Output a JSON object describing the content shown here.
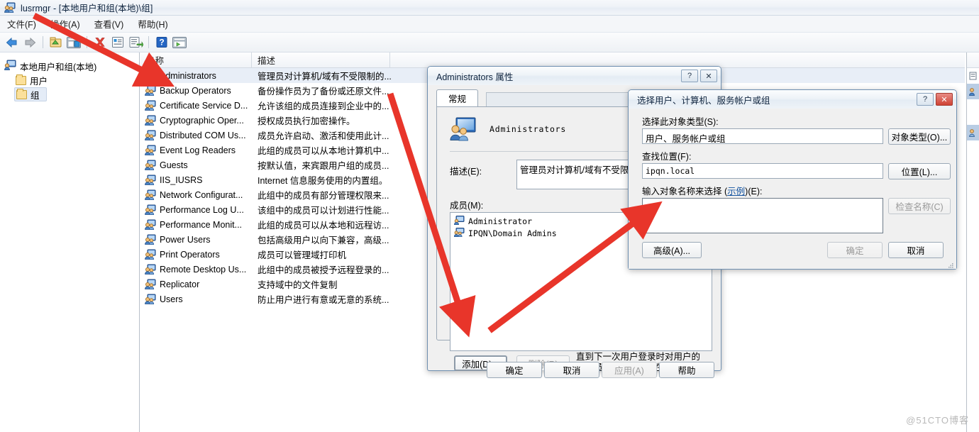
{
  "window": {
    "title": "lusrmgr - [本地用户和组(本地)\\组]",
    "icon": "users-group-icon",
    "menu": [
      "文件(F)",
      "操作(A)",
      "查看(V)",
      "帮助(H)"
    ],
    "toolbar": [
      {
        "name": "back-icon",
        "glyph": "◀"
      },
      {
        "name": "forward-icon",
        "glyph": "▶"
      },
      {
        "name": "up-folder-icon",
        "glyph": "▤"
      },
      {
        "name": "show-hide-tree-icon",
        "glyph": "▥"
      },
      {
        "name": "delete-icon",
        "glyph": "✕"
      },
      {
        "name": "properties-icon",
        "glyph": "▤"
      },
      {
        "name": "export-list-icon",
        "glyph": "▤"
      },
      {
        "name": "help-icon",
        "glyph": "?"
      },
      {
        "name": "new-window-icon",
        "glyph": "▥"
      }
    ]
  },
  "tree": {
    "root": "本地用户和组(本地)",
    "children": [
      "用户",
      "组"
    ]
  },
  "list": {
    "columns": [
      "名称",
      "描述",
      ""
    ],
    "rows": [
      {
        "name": "Administrators",
        "desc": "管理员对计算机/域有不受限制的...",
        "selected": true
      },
      {
        "name": "Backup Operators",
        "desc": "备份操作员为了备份或还原文件...",
        "selected": false
      },
      {
        "name": "Certificate Service D...",
        "desc": "允许该组的成员连接到企业中的...",
        "selected": false
      },
      {
        "name": "Cryptographic Oper...",
        "desc": "授权成员执行加密操作。",
        "selected": false
      },
      {
        "name": "Distributed COM Us...",
        "desc": "成员允许启动、激活和使用此计...",
        "selected": false
      },
      {
        "name": "Event Log Readers",
        "desc": "此组的成员可以从本地计算机中...",
        "selected": false
      },
      {
        "name": "Guests",
        "desc": "按默认值，来宾跟用户组的成员...",
        "selected": false
      },
      {
        "name": "IIS_IUSRS",
        "desc": "Internet 信息服务使用的内置组。",
        "selected": false
      },
      {
        "name": "Network Configurat...",
        "desc": "此组中的成员有部分管理权限来...",
        "selected": false
      },
      {
        "name": "Performance Log U...",
        "desc": "该组中的成员可以计划进行性能...",
        "selected": false
      },
      {
        "name": "Performance Monit...",
        "desc": "此组的成员可以从本地和远程访...",
        "selected": false
      },
      {
        "name": "Power Users",
        "desc": "包括高级用户以向下兼容，高级...",
        "selected": false
      },
      {
        "name": "Print Operators",
        "desc": "成员可以管理域打印机",
        "selected": false
      },
      {
        "name": "Remote Desktop Us...",
        "desc": "此组中的成员被授予远程登录的...",
        "selected": false
      },
      {
        "name": "Replicator",
        "desc": "支持域中的文件复制",
        "selected": false
      },
      {
        "name": "Users",
        "desc": "防止用户进行有意或无意的系统...",
        "selected": false
      }
    ]
  },
  "properties_dialog": {
    "title": "Administrators 属性",
    "help_button": "?",
    "close_button": "✕",
    "tab": "常规",
    "group_name": "Administrators",
    "description_label": "描述(E):",
    "description_value": "管理员对计算机/域有不受限制的",
    "members_label": "成员(M):",
    "members": [
      "Administrator",
      "IPQN\\Domain Admins"
    ],
    "add_button": "添加(D)...",
    "remove_button": "删除(R)",
    "note": "直到下一次用户登录时对用户的组成员关系的更改才生效。",
    "ok_button": "确定",
    "cancel_button": "取消",
    "apply_button": "应用(A)",
    "help_text_button": "帮助"
  },
  "select_dialog": {
    "title": "选择用户、计算机、服务帐户或组",
    "help_button": "?",
    "close_button": "✕",
    "object_type_label": "选择此对象类型(S):",
    "object_type_value": "用户、服务帐户或组",
    "object_types_button": "对象类型(O)...",
    "location_label": "查找位置(F):",
    "location_value": "ipqn.local",
    "locations_button": "位置(L)...",
    "names_label_pre": "输入对象名称来选择 (",
    "names_label_link": "示例",
    "names_label_post": ")(E):",
    "names_value": "",
    "check_names_button": "检查名称(C)",
    "advanced_button": "高级(A)...",
    "ok_button": "确定",
    "cancel_button": "取消"
  },
  "watermark": "@51CTO博客",
  "colors": {
    "arrow_red": "#e8352a",
    "selection_blue": "#e8eef7",
    "dialog_face": "#f0f0f0",
    "link_blue": "#1554a0"
  }
}
